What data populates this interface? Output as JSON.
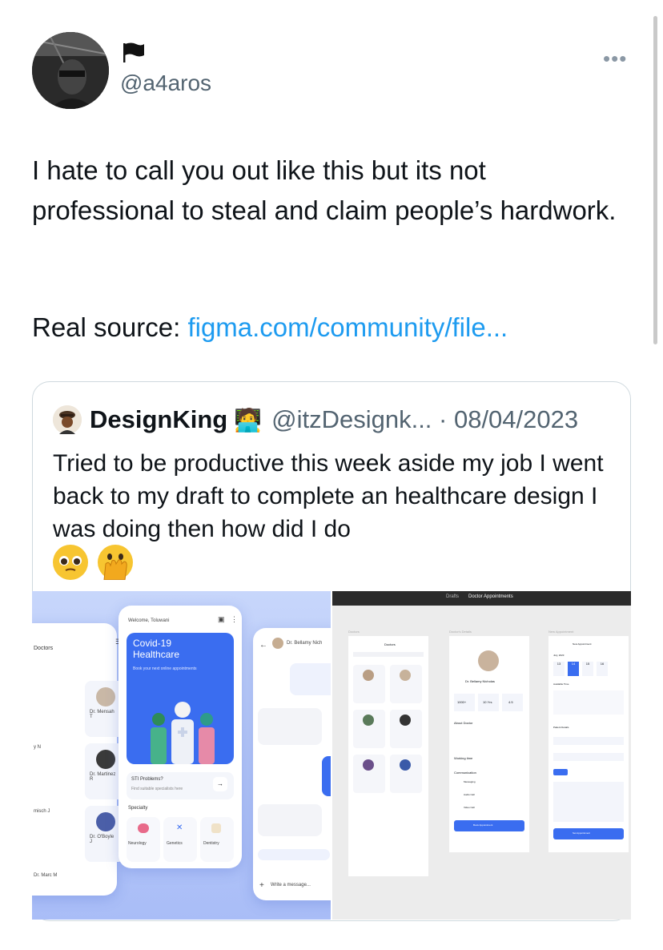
{
  "author": {
    "handle": "@a4aros",
    "avatar_icon": "profile-avatar",
    "flag_icon": "black-flag-icon"
  },
  "menu": {
    "more_label": "•••"
  },
  "tweet": {
    "text": "I hate to call you out like this but its not professional to steal and claim people’s hardwork.",
    "source_prefix": "Real source: ",
    "source_link": "figma.com/community/file..."
  },
  "quote": {
    "name": "DesignKing",
    "badge_icon": "emoji-technologist",
    "handle_date": "@itzDesignk... · 08/04/2023",
    "text": "Tried to be productive this week aside my job I went back to my draft to complete an healthcare design I was doing then how did I do",
    "emoji_icons": [
      "pleading-face-emoji",
      "face-with-hand-over-mouth-emoji"
    ]
  },
  "left_image": {
    "list_title": "Doctors",
    "doctors": [
      "Dr. Mensah T",
      "Dr. Martinez R",
      "Dr. O'Boyle J"
    ],
    "left_names": [
      "y N",
      "misch J",
      "Dr. Marc M"
    ],
    "welcome": "Welcome, Toluwani",
    "banner_title": "Covid-19 Healthcare",
    "banner_sub": "Book your next online appointments",
    "sti_title": "STI Problems?",
    "sti_sub": "Find suitable specialists here",
    "specialty": "Specialty",
    "specialties": [
      "Neurology",
      "Genetics",
      "Dentistry"
    ],
    "chat_name": "Dr. Bellamy Nich",
    "message_placeholder": "Write a message..."
  },
  "right_image": {
    "breadcrumb_a": "Drafts",
    "breadcrumb_b": "Doctor Appointments",
    "section_doctors": "Doctors",
    "section_details": "Doctor's Details",
    "section_new": "New Appointment",
    "doctor_name": "Dr. Bellamy Nicholas",
    "about": "About Doctor",
    "working_time": "Working time",
    "communication": "Communication",
    "comm_items": [
      "Messaging",
      "Audio Call",
      "Video Call"
    ],
    "book_button": "Book Appointment",
    "new_appt_title": "New Appointment",
    "month": "July, 2023",
    "days": [
      "13",
      "14",
      "15",
      "16"
    ],
    "available": "Available Time",
    "patient": "Patient Details",
    "set_button": "Set Appointment",
    "stats": [
      "1000+",
      "10 Yrs",
      "4.5"
    ]
  },
  "colors": {
    "link": "#1d9bf0",
    "secondary_text": "#536471",
    "accent_blue": "#3a6df0"
  }
}
